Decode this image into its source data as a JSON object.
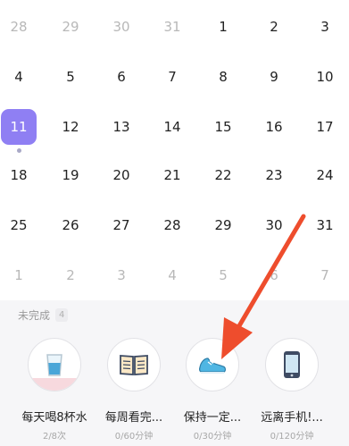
{
  "calendar": {
    "rows": [
      [
        {
          "d": "28",
          "m": true
        },
        {
          "d": "29",
          "m": true
        },
        {
          "d": "30",
          "m": true
        },
        {
          "d": "31",
          "m": true
        },
        {
          "d": "1"
        },
        {
          "d": "2"
        },
        {
          "d": "3"
        }
      ],
      [
        {
          "d": "4"
        },
        {
          "d": "5"
        },
        {
          "d": "6"
        },
        {
          "d": "7"
        },
        {
          "d": "8"
        },
        {
          "d": "9"
        },
        {
          "d": "10"
        }
      ],
      [
        {
          "d": "11",
          "today": true
        },
        {
          "d": "12"
        },
        {
          "d": "13"
        },
        {
          "d": "14"
        },
        {
          "d": "15"
        },
        {
          "d": "16"
        },
        {
          "d": "17"
        }
      ],
      [
        {
          "d": "18"
        },
        {
          "d": "19"
        },
        {
          "d": "20"
        },
        {
          "d": "21"
        },
        {
          "d": "22"
        },
        {
          "d": "23"
        },
        {
          "d": "24"
        }
      ],
      [
        {
          "d": "25"
        },
        {
          "d": "26"
        },
        {
          "d": "27"
        },
        {
          "d": "28"
        },
        {
          "d": "29"
        },
        {
          "d": "30"
        },
        {
          "d": "31"
        }
      ],
      [
        {
          "d": "1",
          "m": true
        },
        {
          "d": "2",
          "m": true
        },
        {
          "d": "3",
          "m": true
        },
        {
          "d": "4",
          "m": true
        },
        {
          "d": "5",
          "m": true
        },
        {
          "d": "6",
          "m": true
        },
        {
          "d": "7",
          "m": true
        }
      ]
    ],
    "today_color": "#8f7ff3"
  },
  "section": {
    "title": "未完成",
    "count": "4"
  },
  "habits": [
    {
      "label": "每天喝8杯水",
      "progress": "2/8次",
      "icon": "water-glass-icon",
      "fill_fraction": 0.25
    },
    {
      "label": "每周看完...",
      "progress": "0/60分钟",
      "icon": "open-book-icon",
      "fill_fraction": 0
    },
    {
      "label": "保持一定...",
      "progress": "0/30分钟",
      "icon": "running-shoe-icon",
      "fill_fraction": 0
    },
    {
      "label": "远离手机!...",
      "progress": "0/120分钟",
      "icon": "phone-icon",
      "fill_fraction": 0
    }
  ],
  "colors": {
    "accent": "#8f7ff3",
    "arrow": "#ee4d2d",
    "water_fill": "#f7d9de"
  }
}
